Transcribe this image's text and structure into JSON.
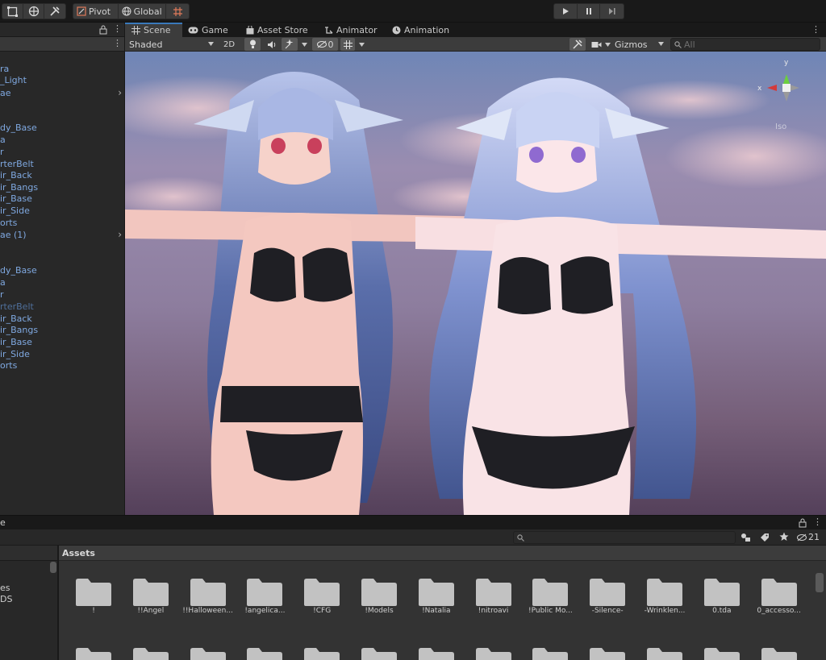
{
  "toolbar": {
    "pivot_label": "Pivot",
    "global_label": "Global"
  },
  "hierarchy": {
    "items": [
      {
        "label": "ra",
        "style": "blue"
      },
      {
        "label": "_Light",
        "style": "blue"
      },
      {
        "label": "ae",
        "style": "blue",
        "has_children": true
      },
      {
        "label": "dy_Base",
        "style": "blue"
      },
      {
        "label": "a",
        "style": "blue"
      },
      {
        "label": "r",
        "style": "blue"
      },
      {
        "label": "rterBelt",
        "style": "blue"
      },
      {
        "label": "ir_Back",
        "style": "blue"
      },
      {
        "label": "ir_Bangs",
        "style": "blue"
      },
      {
        "label": "ir_Base",
        "style": "blue"
      },
      {
        "label": "ir_Side",
        "style": "blue"
      },
      {
        "label": "orts",
        "style": "blue"
      },
      {
        "label": "ae (1)",
        "style": "blue",
        "has_children": true
      },
      {
        "label": "dy_Base",
        "style": "blue"
      },
      {
        "label": "a",
        "style": "blue"
      },
      {
        "label": "r",
        "style": "blue"
      },
      {
        "label": "rterBelt",
        "style": "dim"
      },
      {
        "label": "ir_Back",
        "style": "blue"
      },
      {
        "label": "ir_Bangs",
        "style": "blue"
      },
      {
        "label": "ir_Base",
        "style": "blue"
      },
      {
        "label": "ir_Side",
        "style": "blue"
      },
      {
        "label": "orts",
        "style": "blue"
      }
    ]
  },
  "scene": {
    "tabs": [
      {
        "label": "Scene",
        "icon": "grid-icon"
      },
      {
        "label": "Game",
        "icon": "gamepad-icon"
      },
      {
        "label": "Asset Store",
        "icon": "bag-icon"
      },
      {
        "label": "Animator",
        "icon": "animator-icon"
      },
      {
        "label": "Animation",
        "icon": "clock-icon"
      }
    ],
    "shading_mode": "Shaded",
    "mode_2d": "2D",
    "hidden_count": "0",
    "gizmos_label": "Gizmos",
    "search_placeholder": "All",
    "gizmo_axis_x": "x",
    "gizmo_axis_y": "y",
    "gizmo_view": "Iso"
  },
  "project": {
    "title": "e",
    "assets_label": "Assets",
    "hidden_count": "21",
    "left_items": [
      "es",
      "DS"
    ],
    "folders": [
      "!",
      "!!Angel",
      "!!Halloween...",
      "!angelica...",
      "!CFG",
      "!Models",
      "!Natalia",
      "!nitroavi",
      "!Public Mo...",
      "-Silence-",
      "-Wrinklen...",
      "0.tda",
      "0_accesso..."
    ]
  },
  "colors": {
    "accent": "#3a79bb",
    "panel": "#282828",
    "header": "#191919",
    "hierarchy_text": "#7fa8e0"
  }
}
